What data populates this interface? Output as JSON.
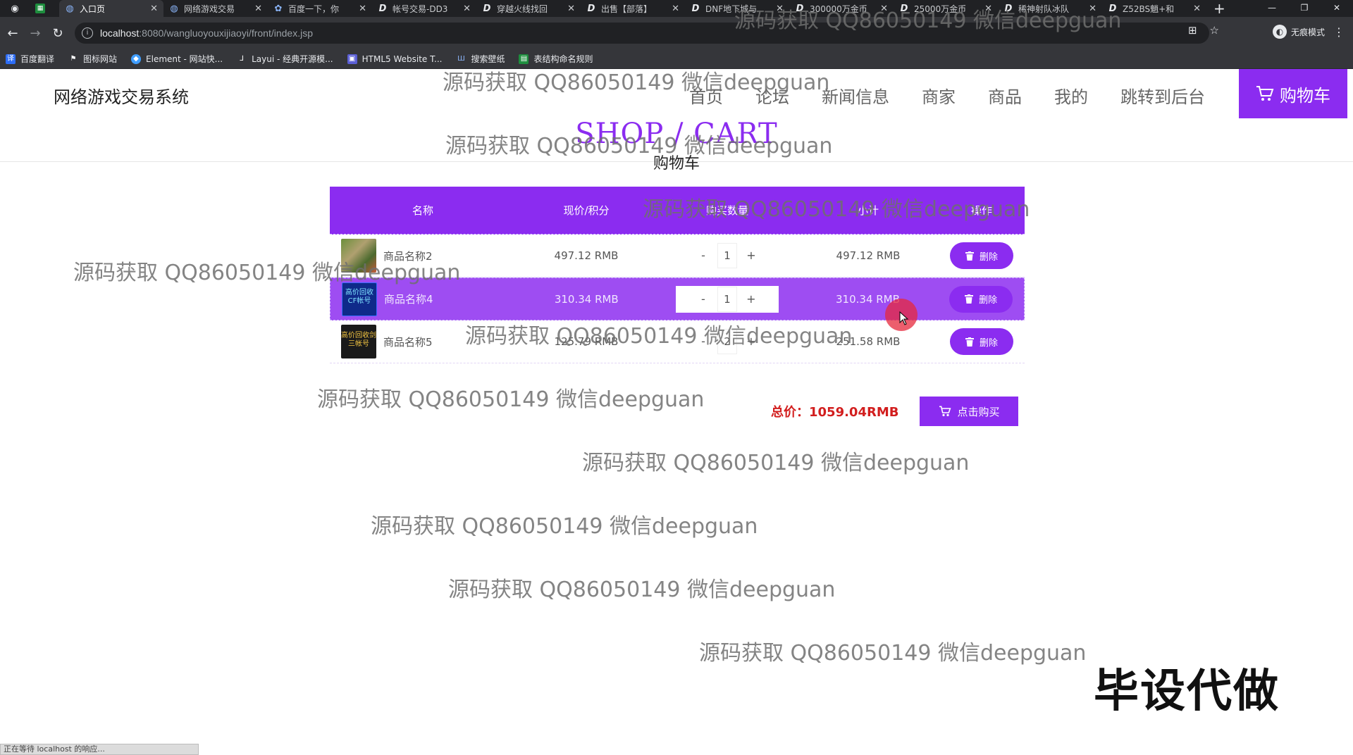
{
  "browser": {
    "tabs": [
      {
        "title": "",
        "favicon": "green-sheet-icon"
      },
      {
        "title": "入口页",
        "favicon": "globe-icon"
      },
      {
        "title": "网络游戏交易",
        "favicon": "globe-icon"
      },
      {
        "title": "百度一下，你",
        "favicon": "baidu-icon"
      },
      {
        "title": "帐号交易-DD3",
        "favicon": "d-icon"
      },
      {
        "title": "穿越火线找回",
        "favicon": "d-icon"
      },
      {
        "title": "出售【部落】",
        "favicon": "d-icon"
      },
      {
        "title": "DNF地下城与",
        "favicon": "d-icon"
      },
      {
        "title": "300000万金币",
        "favicon": "d-icon"
      },
      {
        "title": "25000万金币",
        "favicon": "d-icon"
      },
      {
        "title": "稀神射队冰队",
        "favicon": "d-icon"
      },
      {
        "title": "Z52BS魈+和",
        "favicon": "d-icon"
      }
    ],
    "url_host": "localhost",
    "url_rest": ":8080/wangluoyouxijiaoyi/front/index.jsp",
    "profile_label": "无痕模式",
    "bookmarks": [
      "百度翻译",
      "图标网站",
      "Element - 网站快...",
      "Layui - 经典开源模...",
      "HTML5 Website T...",
      "搜索壁纸",
      "表结构命名规则"
    ],
    "status_text": "正在等待 localhost 的响应..."
  },
  "site": {
    "title": "网络游戏交易系统",
    "nav": [
      "首页",
      "论坛",
      "新闻信息",
      "商家",
      "商品",
      "我的",
      "跳转到后台"
    ],
    "cart_label": "购物车"
  },
  "section": {
    "en_title": "SHOP / CART",
    "cn_title": "购物车"
  },
  "table": {
    "headers": [
      "名称",
      "现价/积分",
      "购买数量",
      "小计",
      "操作"
    ],
    "rows": [
      {
        "name": "商品名称2",
        "price": "497.12 RMB",
        "qty": "1",
        "subtotal": "497.12 RMB",
        "action": "删除"
      },
      {
        "name": "商品名称4",
        "price": "310.34 RMB",
        "qty": "1",
        "subtotal": "310.34 RMB",
        "action": "删除"
      },
      {
        "name": "商品名称5",
        "price": "125.79 RMB",
        "qty": "2",
        "subtotal": "251.58 RMB",
        "action": "删除"
      }
    ],
    "minus": "-",
    "plus": "+",
    "thumb2_text": "高价回收CF帐号",
    "thumb3_text": "高价回收剑三帐号"
  },
  "summary": {
    "total": "总价：1059.04RMB",
    "buy_label": "点击购买"
  },
  "overlay": {
    "watermark": "源码获取 QQ86050149 微信deepguan",
    "corner": "毕设代做"
  },
  "colors": {
    "accent": "#8b2cf0",
    "total_red": "#d21e1e",
    "browser_dark": "#202124"
  }
}
